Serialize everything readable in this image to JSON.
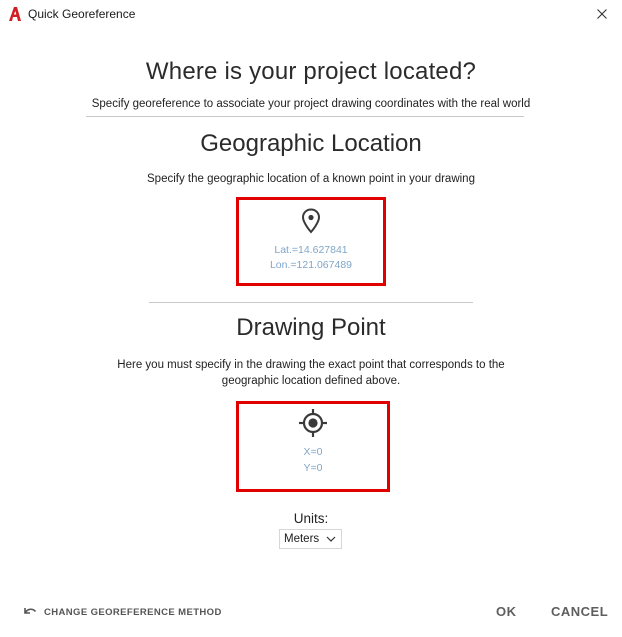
{
  "window": {
    "title": "Quick Georeference",
    "app_icon": "autocad-icon",
    "close_icon": "close-icon"
  },
  "main": {
    "heading": "Where is your project located?",
    "subtitle": "Specify georeference to associate your project drawing coordinates with the real world"
  },
  "geographic": {
    "heading": "Geographic Location",
    "subtitle": "Specify the geographic location of a known point in your drawing",
    "icon": "location-pin-icon",
    "lat": "Lat.=14.627841",
    "lon": "Lon.=121.067489"
  },
  "drawing": {
    "heading": "Drawing Point",
    "subtitle_line1": "Here you must specify in the drawing the exact point that corresponds to the",
    "subtitle_line2": "geographic location defined above.",
    "icon": "target-icon",
    "x": "X=0",
    "y": "Y=0"
  },
  "units": {
    "label": "Units:",
    "selected": "Meters"
  },
  "footer": {
    "change_method": "CHANGE GEOREFERENCE METHOD",
    "ok": "OK",
    "cancel": "CANCEL"
  },
  "colors": {
    "highlight_border": "#e00000",
    "coordinate_text": "#7fa6c9",
    "app_red": "#d21f26"
  }
}
